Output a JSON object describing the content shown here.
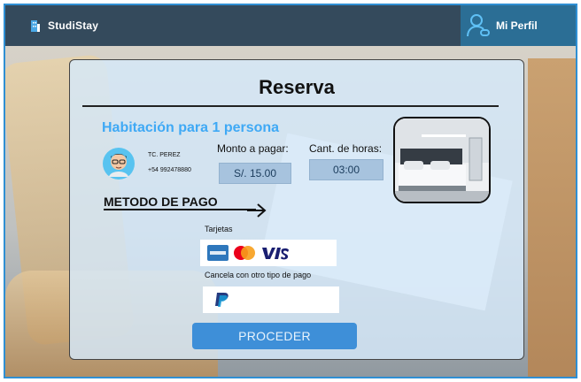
{
  "header": {
    "brand_name": "StudiStay",
    "profile_label": "Mi Perfil"
  },
  "booking": {
    "title": "Reserva",
    "room_title": "Habitación para 1 persona",
    "user": {
      "name": "TC. PEREZ",
      "phone": "+54 992478880"
    },
    "amount_label": "Monto a pagar:",
    "amount_value": "S/. 15.00",
    "hours_label": "Cant. de horas:",
    "hours_value": "03:00"
  },
  "payment": {
    "title": "METODO DE PAGO",
    "cards_label": "Tarjetas",
    "card_brands": [
      "AMEX",
      "MasterCard",
      "VISA"
    ],
    "alt_label": "Cancela con otro tipo de pago",
    "alt_method": "PayPal",
    "proceed_label": "PROCEDER"
  },
  "colors": {
    "header_bg": "#344a5c",
    "profile_bg": "#2b6e95",
    "accent": "#3fa9f5",
    "button": "#3e8fd8"
  }
}
